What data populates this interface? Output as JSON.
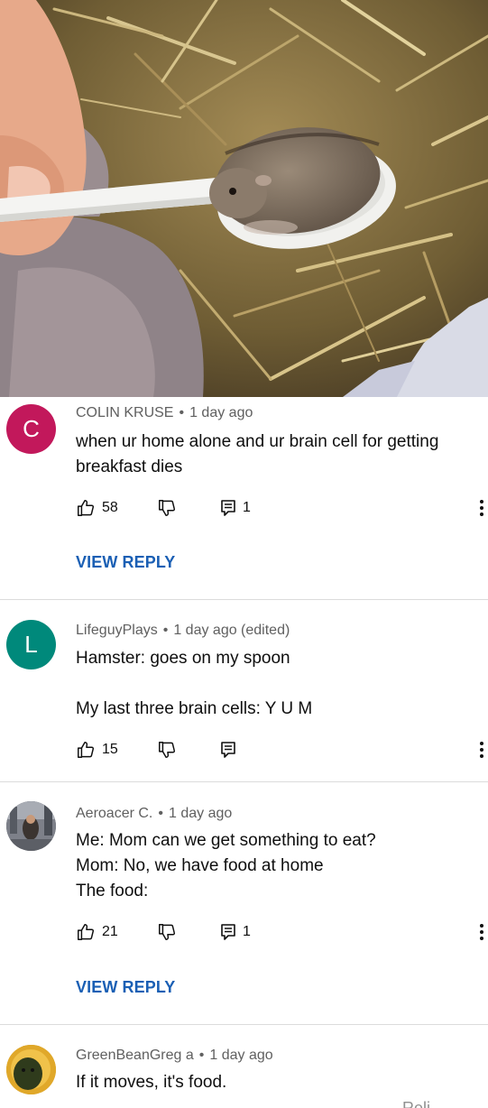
{
  "comments": [
    {
      "avatar_letter": "C",
      "avatar_color": "#c2185b",
      "author": "COLIN KRUSE",
      "time": "1 day ago",
      "lines": [
        "when ur home alone and ur brain cell for getting",
        "breakfast dies"
      ],
      "likes": "58",
      "replies": "1",
      "view_reply": "VIEW REPLY"
    },
    {
      "avatar_letter": "L",
      "avatar_color": "#00897b",
      "author": "LifeguyPlays",
      "time": "1 day ago (edited)",
      "lines": [
        "Hamster: goes on my spoon",
        "",
        "My last three brain cells: Y U M"
      ],
      "likes": "15",
      "replies": ""
    },
    {
      "avatar_letter": "",
      "author": "Aeroacer C.",
      "time": "1 day ago",
      "lines": [
        "Me: Mom can we get something to eat?",
        "Mom: No, we have food at home",
        "The food:"
      ],
      "likes": "21",
      "replies": "1",
      "view_reply": "VIEW REPLY"
    },
    {
      "avatar_letter": "",
      "author": "GreenBeanGreg a",
      "time": "1 day ago",
      "lines": [
        "If it moves, it's food."
      ]
    }
  ],
  "separator": "•",
  "cut_off_text": "Reli",
  "colors": {
    "link": "#1a5fb4",
    "meta": "#606060",
    "divider": "#dcdcdc"
  },
  "icons": [
    "thumb-up-icon",
    "thumb-down-icon",
    "reply-icon",
    "more-vert-icon"
  ]
}
